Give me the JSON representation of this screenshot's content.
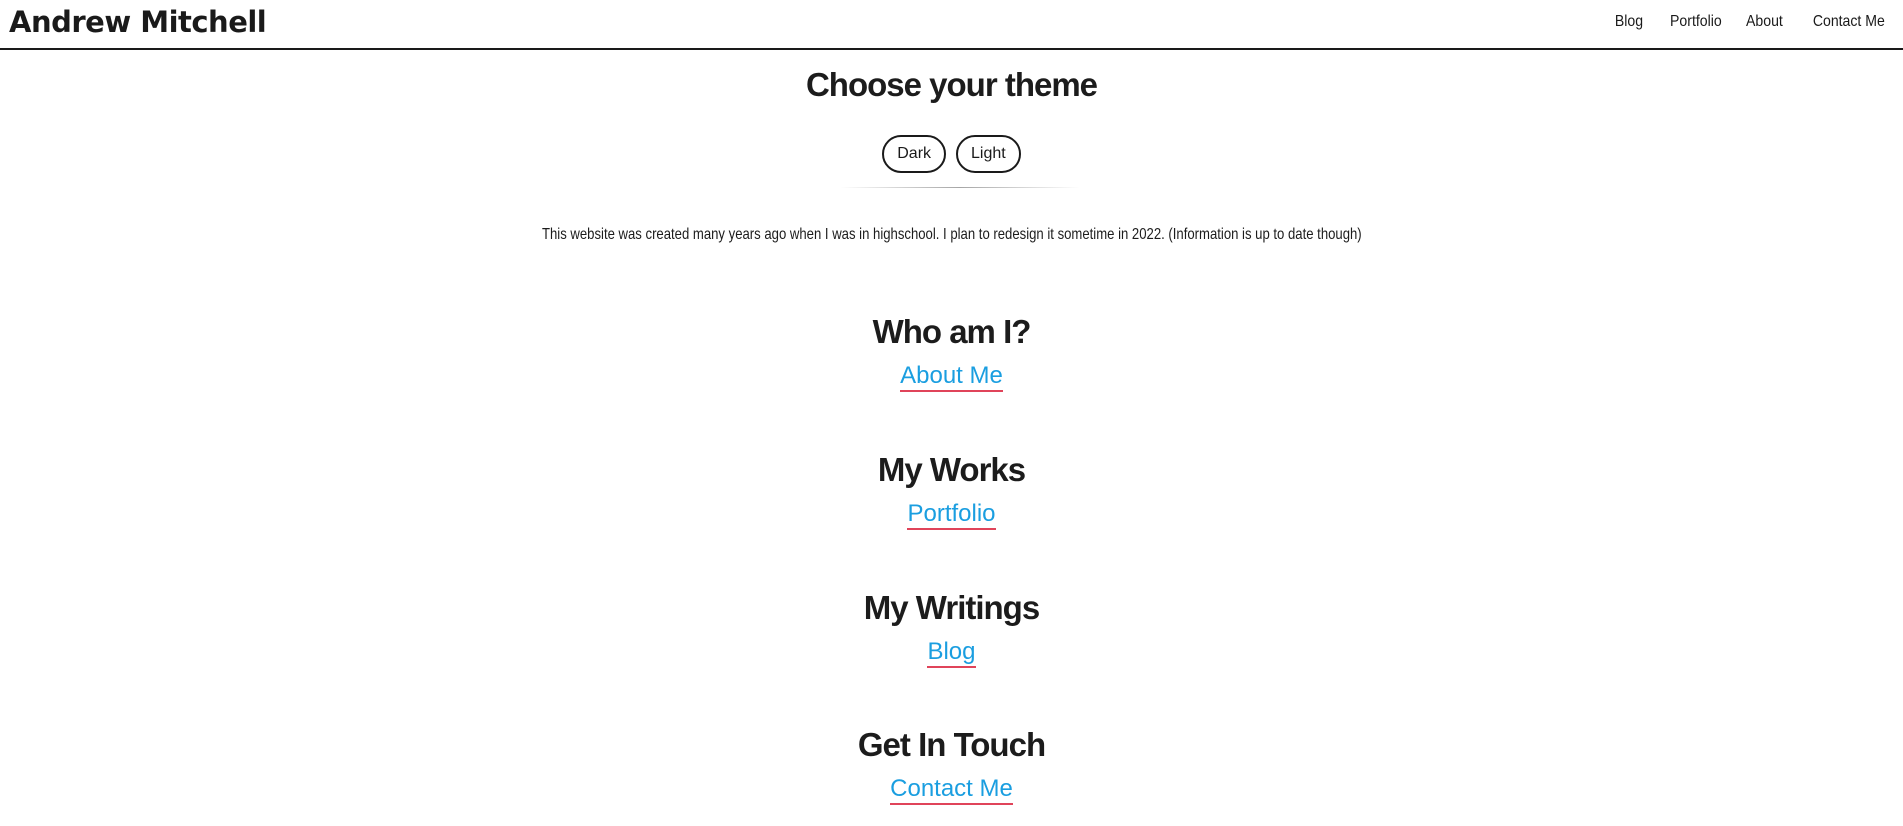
{
  "header": {
    "brand": "Andrew Mitchell",
    "nav": [
      "Blog",
      "Portfolio",
      "About",
      "Contact Me"
    ]
  },
  "theme": {
    "title": "Choose your theme",
    "buttons": [
      "Dark",
      "Light"
    ]
  },
  "notice": "This website was created many years ago when I was in highschool. I plan to redesign it sometime in 2022. (Information is up to date though)",
  "sections": [
    {
      "heading": "Who am I?",
      "link": "About Me"
    },
    {
      "heading": "My Works",
      "link": "Portfolio"
    },
    {
      "heading": "My Writings",
      "link": "Blog"
    },
    {
      "heading": "Get In Touch",
      "link": "Contact Me"
    }
  ],
  "colors": {
    "link": "#1a9ee0",
    "link_underline": "#e0445a",
    "text": "#1c1c1c"
  }
}
